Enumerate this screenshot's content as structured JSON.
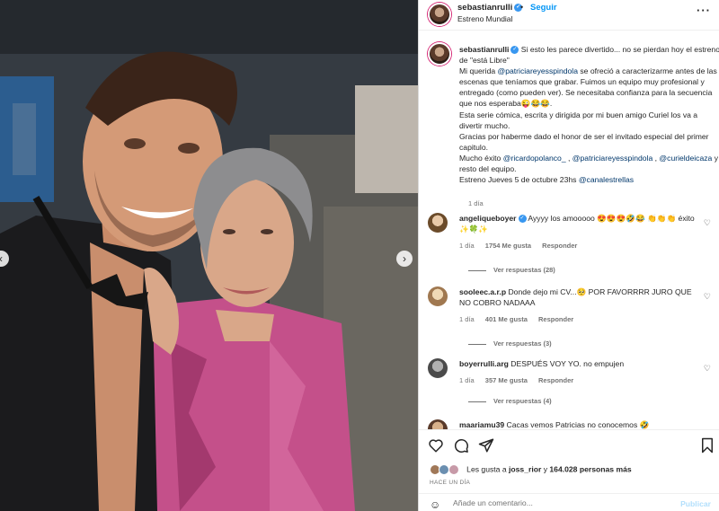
{
  "post": {
    "username": "sebastianrulli",
    "separator": "•",
    "follow_label": "Seguir",
    "subtitle": "Estreno Mundial",
    "more_label": "···"
  },
  "caption": {
    "username": "sebastianrulli",
    "segments": [
      {
        "t": " Si esto les parece divertido... no se pierdan hoy el estreno de \"está Libre\""
      },
      {
        "br": true
      },
      {
        "t": "Mi querida "
      },
      {
        "m": "@patriciareyesspindola"
      },
      {
        "t": " se ofreció a caracterizarme antes de las escenas que teníamos que grabar. Fuimos un equipo muy profesional y entregado (como pueden ver). Se necesitaba confianza para la secuencia que nos esperaba😜😂😂."
      },
      {
        "br": true
      },
      {
        "t": "Esta serie cómica, escrita y dirigida por mi buen amigo Curiel los va a divertir mucho."
      },
      {
        "br": true
      },
      {
        "t": "Gracias por haberme dado el honor de ser el invitado especial del primer capitulo."
      },
      {
        "br": true
      },
      {
        "t": "Mucho éxito "
      },
      {
        "m": "@ricardopolanco_"
      },
      {
        "t": " , "
      },
      {
        "m": "@patriciareyesspindola"
      },
      {
        "t": " , "
      },
      {
        "m": "@curieldeicaza"
      },
      {
        "t": " y resto del equipo."
      },
      {
        "br": true
      },
      {
        "t": "Estreno Jueves 5 de octubre 23hs "
      },
      {
        "m": "@canalestrellas"
      }
    ],
    "age": "1 día"
  },
  "comments": [
    {
      "user": "angeliqueboyer",
      "text": " Ayyyy los amooooo 😍😍😍🤣😂 👏👏👏 éxito ✨🍀✨",
      "age": "1 día",
      "likes": "1754 Me gusta",
      "reply": "Responder",
      "replies": "Ver respuestas (28)"
    },
    {
      "user": "sooleec.a.r.p",
      "text": " Donde dejo mi CV...🥺  POR FAVORRRR JURO QUE NO COBRO NADAAA",
      "age": "1 día",
      "likes": "401 Me gusta",
      "reply": "Responder",
      "replies": "Ver respuestas (3)"
    },
    {
      "user": "boyerrulli.arg",
      "text": " DESPUÉS VOY YO. no empujen",
      "age": "1 día",
      "likes": "357 Me gusta",
      "reply": "Responder",
      "replies": "Ver respuestas (4)"
    },
    {
      "user": "maariamu39",
      "text": " Cacas vemos Patricias no conocemos 🤣",
      "age": "",
      "likes": "",
      "reply": "",
      "replies": ""
    }
  ],
  "likes_line": {
    "prefix": "Les gusta a ",
    "user": "joss_rior",
    "middle": " y ",
    "count": "164.028 personas más"
  },
  "timestamp": "HACE UN DÍA",
  "add_comment": {
    "placeholder": "Añade un comentario...",
    "publish": "Publicar"
  },
  "colors": {
    "link": "#0095f6",
    "mention": "#00376b",
    "muted": "#737373",
    "publish_disabled": "#b2dffc"
  },
  "icons": {
    "like": "heart-icon",
    "comment": "comment-icon",
    "share": "send-icon",
    "save": "bookmark-icon",
    "emoji": "emoji-icon",
    "prev": "chevron-left-icon",
    "next": "chevron-right-icon"
  }
}
